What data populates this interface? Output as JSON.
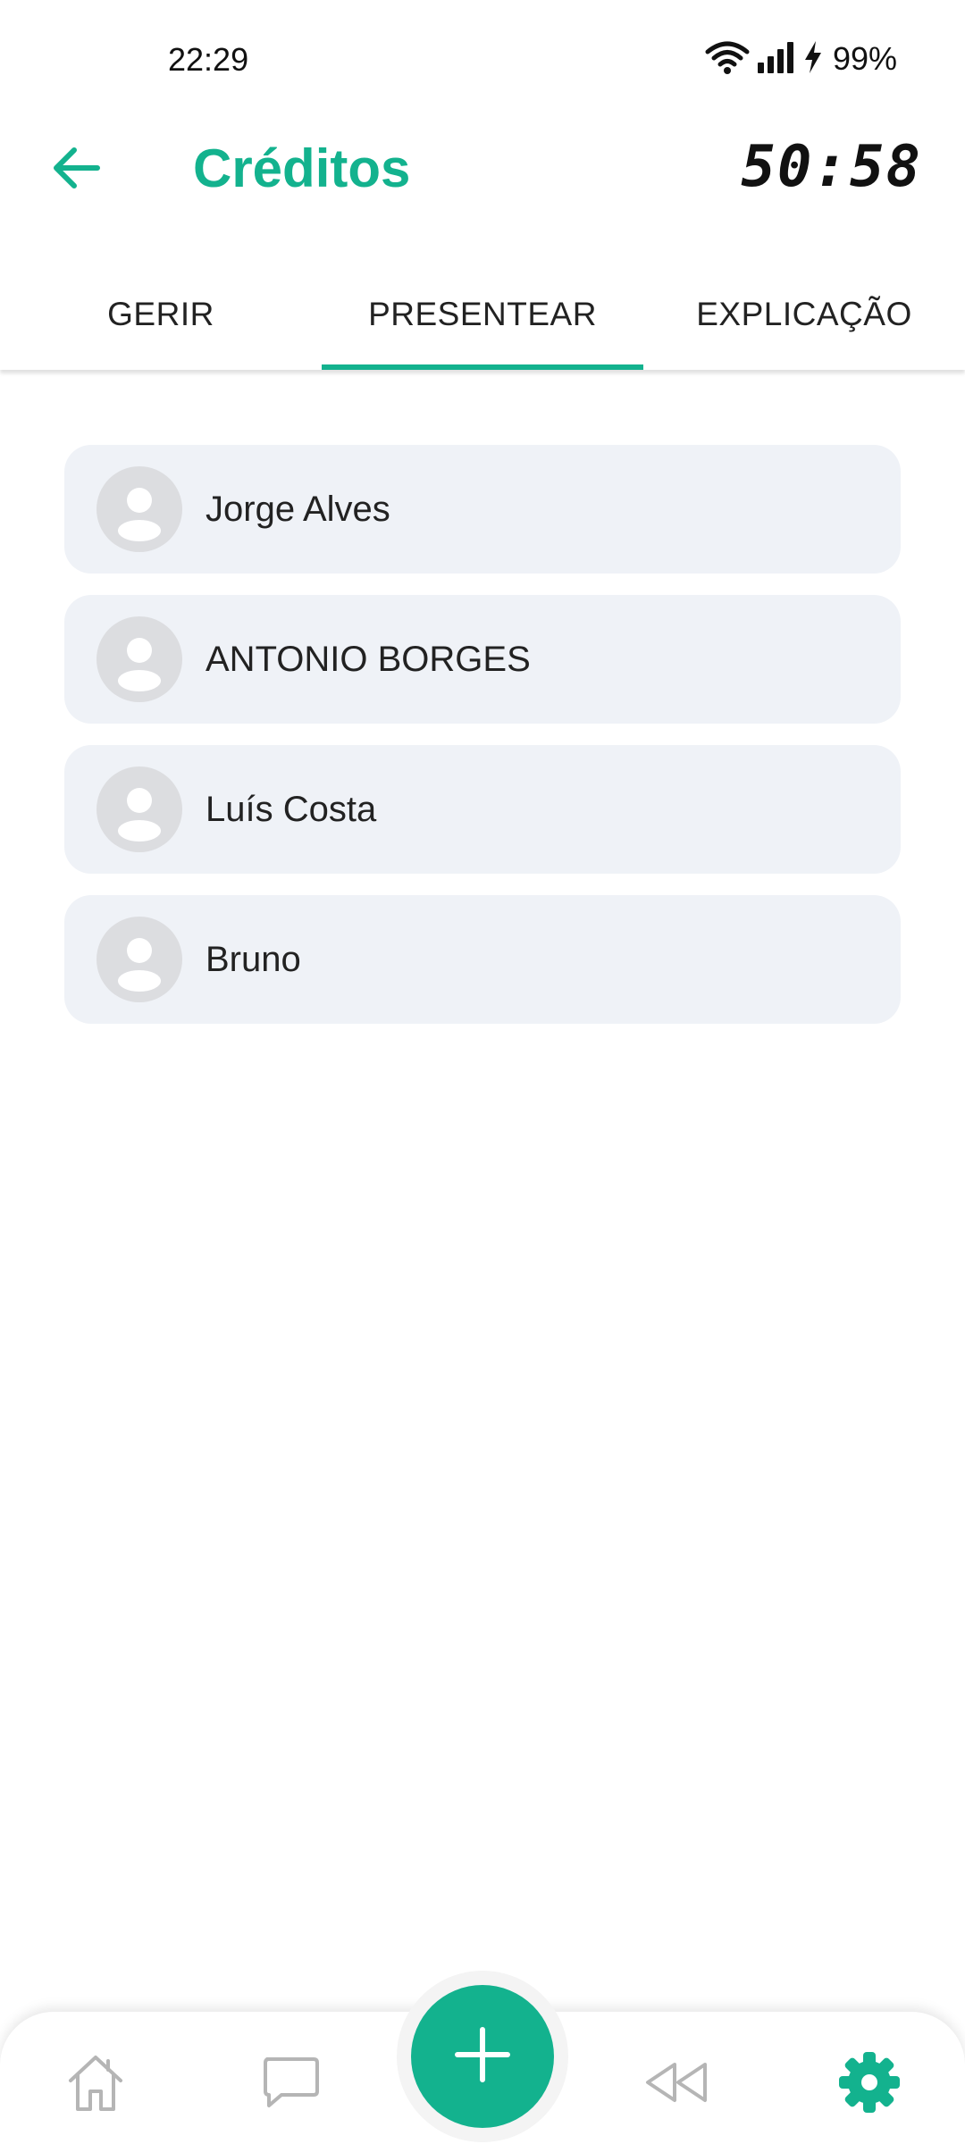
{
  "status_bar": {
    "time": "22:29",
    "battery": "99%",
    "icons": [
      "wifi-icon",
      "signal-icon",
      "charging-icon"
    ]
  },
  "header": {
    "title": "Créditos",
    "timer": "50:58",
    "back_icon": "arrow-left-icon"
  },
  "tabs": [
    {
      "label": "GERIR"
    },
    {
      "label": "PRESENTEAR"
    },
    {
      "label": "EXPLICAÇÃO"
    }
  ],
  "active_tab": "PRESENTEAR",
  "contacts": [
    {
      "name": "Jorge Alves"
    },
    {
      "name": "ANTONIO BORGES"
    },
    {
      "name": "Luís Costa"
    },
    {
      "name": "Bruno"
    }
  ],
  "bottom_nav": {
    "items": [
      "home-icon",
      "chat-icon",
      "add-icon",
      "rewind-icon",
      "settings-icon"
    ],
    "active": "settings-icon"
  },
  "colors": {
    "accent": "#13b28e",
    "card_background": "#eff2f7",
    "avatar_background": "#dcdde0",
    "inactive_icon": "#b5b5b5"
  }
}
